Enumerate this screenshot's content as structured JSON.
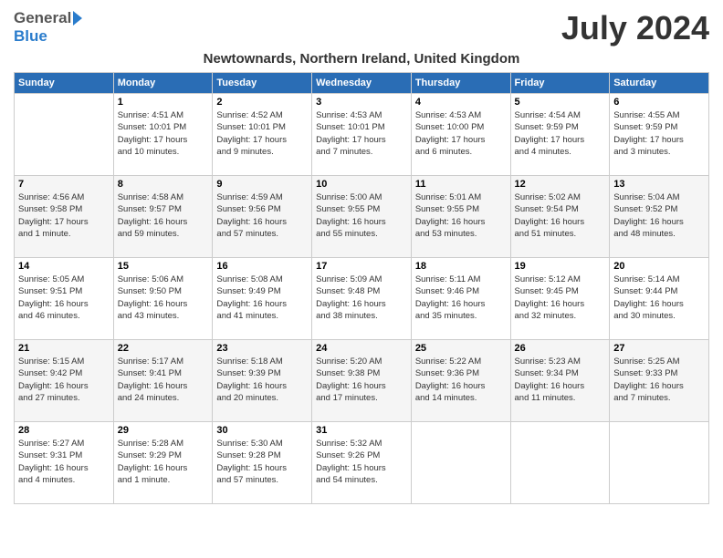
{
  "logo": {
    "general": "General",
    "blue": "Blue"
  },
  "title": "July 2024",
  "location": "Newtownards, Northern Ireland, United Kingdom",
  "days_of_week": [
    "Sunday",
    "Monday",
    "Tuesday",
    "Wednesday",
    "Thursday",
    "Friday",
    "Saturday"
  ],
  "weeks": [
    [
      {
        "day": "",
        "info": ""
      },
      {
        "day": "1",
        "info": "Sunrise: 4:51 AM\nSunset: 10:01 PM\nDaylight: 17 hours\nand 10 minutes."
      },
      {
        "day": "2",
        "info": "Sunrise: 4:52 AM\nSunset: 10:01 PM\nDaylight: 17 hours\nand 9 minutes."
      },
      {
        "day": "3",
        "info": "Sunrise: 4:53 AM\nSunset: 10:01 PM\nDaylight: 17 hours\nand 7 minutes."
      },
      {
        "day": "4",
        "info": "Sunrise: 4:53 AM\nSunset: 10:00 PM\nDaylight: 17 hours\nand 6 minutes."
      },
      {
        "day": "5",
        "info": "Sunrise: 4:54 AM\nSunset: 9:59 PM\nDaylight: 17 hours\nand 4 minutes."
      },
      {
        "day": "6",
        "info": "Sunrise: 4:55 AM\nSunset: 9:59 PM\nDaylight: 17 hours\nand 3 minutes."
      }
    ],
    [
      {
        "day": "7",
        "info": "Sunrise: 4:56 AM\nSunset: 9:58 PM\nDaylight: 17 hours\nand 1 minute."
      },
      {
        "day": "8",
        "info": "Sunrise: 4:58 AM\nSunset: 9:57 PM\nDaylight: 16 hours\nand 59 minutes."
      },
      {
        "day": "9",
        "info": "Sunrise: 4:59 AM\nSunset: 9:56 PM\nDaylight: 16 hours\nand 57 minutes."
      },
      {
        "day": "10",
        "info": "Sunrise: 5:00 AM\nSunset: 9:55 PM\nDaylight: 16 hours\nand 55 minutes."
      },
      {
        "day": "11",
        "info": "Sunrise: 5:01 AM\nSunset: 9:55 PM\nDaylight: 16 hours\nand 53 minutes."
      },
      {
        "day": "12",
        "info": "Sunrise: 5:02 AM\nSunset: 9:54 PM\nDaylight: 16 hours\nand 51 minutes."
      },
      {
        "day": "13",
        "info": "Sunrise: 5:04 AM\nSunset: 9:52 PM\nDaylight: 16 hours\nand 48 minutes."
      }
    ],
    [
      {
        "day": "14",
        "info": "Sunrise: 5:05 AM\nSunset: 9:51 PM\nDaylight: 16 hours\nand 46 minutes."
      },
      {
        "day": "15",
        "info": "Sunrise: 5:06 AM\nSunset: 9:50 PM\nDaylight: 16 hours\nand 43 minutes."
      },
      {
        "day": "16",
        "info": "Sunrise: 5:08 AM\nSunset: 9:49 PM\nDaylight: 16 hours\nand 41 minutes."
      },
      {
        "day": "17",
        "info": "Sunrise: 5:09 AM\nSunset: 9:48 PM\nDaylight: 16 hours\nand 38 minutes."
      },
      {
        "day": "18",
        "info": "Sunrise: 5:11 AM\nSunset: 9:46 PM\nDaylight: 16 hours\nand 35 minutes."
      },
      {
        "day": "19",
        "info": "Sunrise: 5:12 AM\nSunset: 9:45 PM\nDaylight: 16 hours\nand 32 minutes."
      },
      {
        "day": "20",
        "info": "Sunrise: 5:14 AM\nSunset: 9:44 PM\nDaylight: 16 hours\nand 30 minutes."
      }
    ],
    [
      {
        "day": "21",
        "info": "Sunrise: 5:15 AM\nSunset: 9:42 PM\nDaylight: 16 hours\nand 27 minutes."
      },
      {
        "day": "22",
        "info": "Sunrise: 5:17 AM\nSunset: 9:41 PM\nDaylight: 16 hours\nand 24 minutes."
      },
      {
        "day": "23",
        "info": "Sunrise: 5:18 AM\nSunset: 9:39 PM\nDaylight: 16 hours\nand 20 minutes."
      },
      {
        "day": "24",
        "info": "Sunrise: 5:20 AM\nSunset: 9:38 PM\nDaylight: 16 hours\nand 17 minutes."
      },
      {
        "day": "25",
        "info": "Sunrise: 5:22 AM\nSunset: 9:36 PM\nDaylight: 16 hours\nand 14 minutes."
      },
      {
        "day": "26",
        "info": "Sunrise: 5:23 AM\nSunset: 9:34 PM\nDaylight: 16 hours\nand 11 minutes."
      },
      {
        "day": "27",
        "info": "Sunrise: 5:25 AM\nSunset: 9:33 PM\nDaylight: 16 hours\nand 7 minutes."
      }
    ],
    [
      {
        "day": "28",
        "info": "Sunrise: 5:27 AM\nSunset: 9:31 PM\nDaylight: 16 hours\nand 4 minutes."
      },
      {
        "day": "29",
        "info": "Sunrise: 5:28 AM\nSunset: 9:29 PM\nDaylight: 16 hours\nand 1 minute."
      },
      {
        "day": "30",
        "info": "Sunrise: 5:30 AM\nSunset: 9:28 PM\nDaylight: 15 hours\nand 57 minutes."
      },
      {
        "day": "31",
        "info": "Sunrise: 5:32 AM\nSunset: 9:26 PM\nDaylight: 15 hours\nand 54 minutes."
      },
      {
        "day": "",
        "info": ""
      },
      {
        "day": "",
        "info": ""
      },
      {
        "day": "",
        "info": ""
      }
    ]
  ]
}
